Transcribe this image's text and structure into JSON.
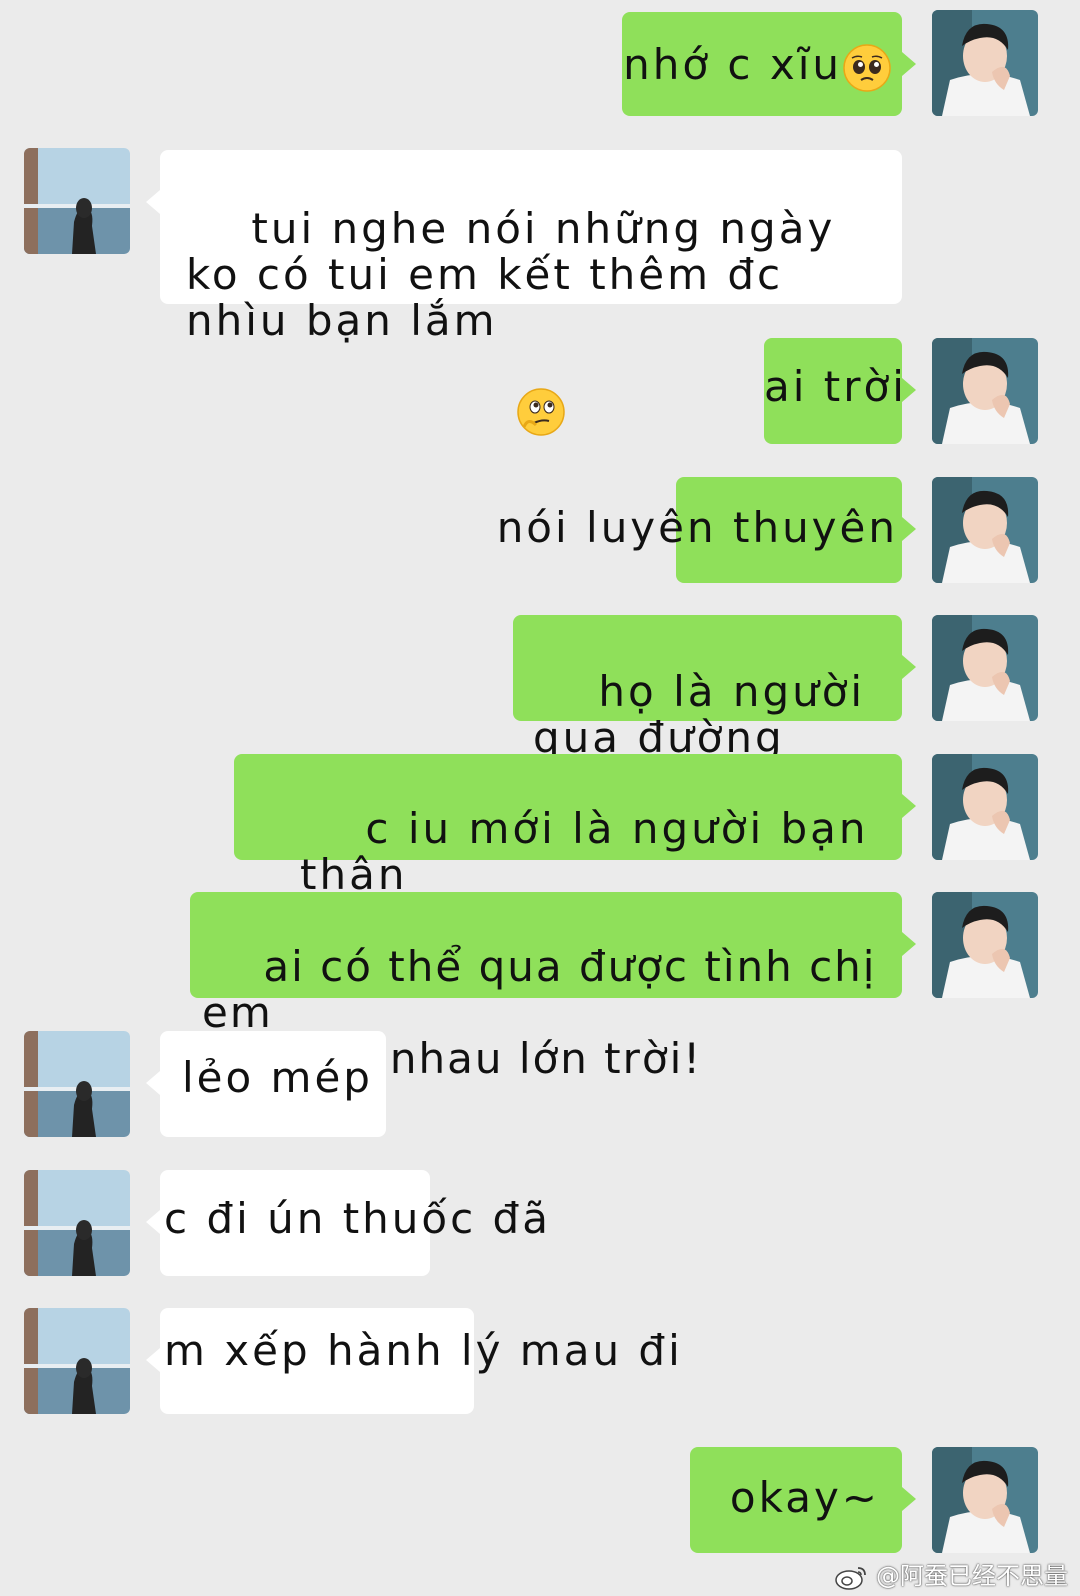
{
  "messages": [
    {
      "side": "out",
      "text": "nhớ c xĩu",
      "emoji": "pleading-face"
    },
    {
      "side": "in",
      "text": "tui nghe nói những ngày\nko có tui em kết thêm đc\nnhìu bạn lắm",
      "emoji": "thinking-face"
    },
    {
      "side": "out",
      "text": "ai trời"
    },
    {
      "side": "out",
      "text": "nói luyên thuyên"
    },
    {
      "side": "out",
      "text": "họ là người\nqua đường thui~"
    },
    {
      "side": "out",
      "text": "c iu mới là người bạn thân\nnhấttttt của em"
    },
    {
      "side": "out",
      "text": "ai có thể qua được tình chị em\nta cùng nhau lớn trời!"
    },
    {
      "side": "in",
      "text": "lẻo mép"
    },
    {
      "side": "in",
      "text": "c đi ún thuốc đã"
    },
    {
      "side": "in",
      "text": "m xếp hành lý mau đi"
    },
    {
      "side": "out",
      "text": "okay~"
    }
  ],
  "watermark": "@阿蚕已经不思量",
  "colors": {
    "background": "#ebebeb",
    "outgoing_bubble": "#8fe05a",
    "incoming_bubble": "#ffffff"
  }
}
